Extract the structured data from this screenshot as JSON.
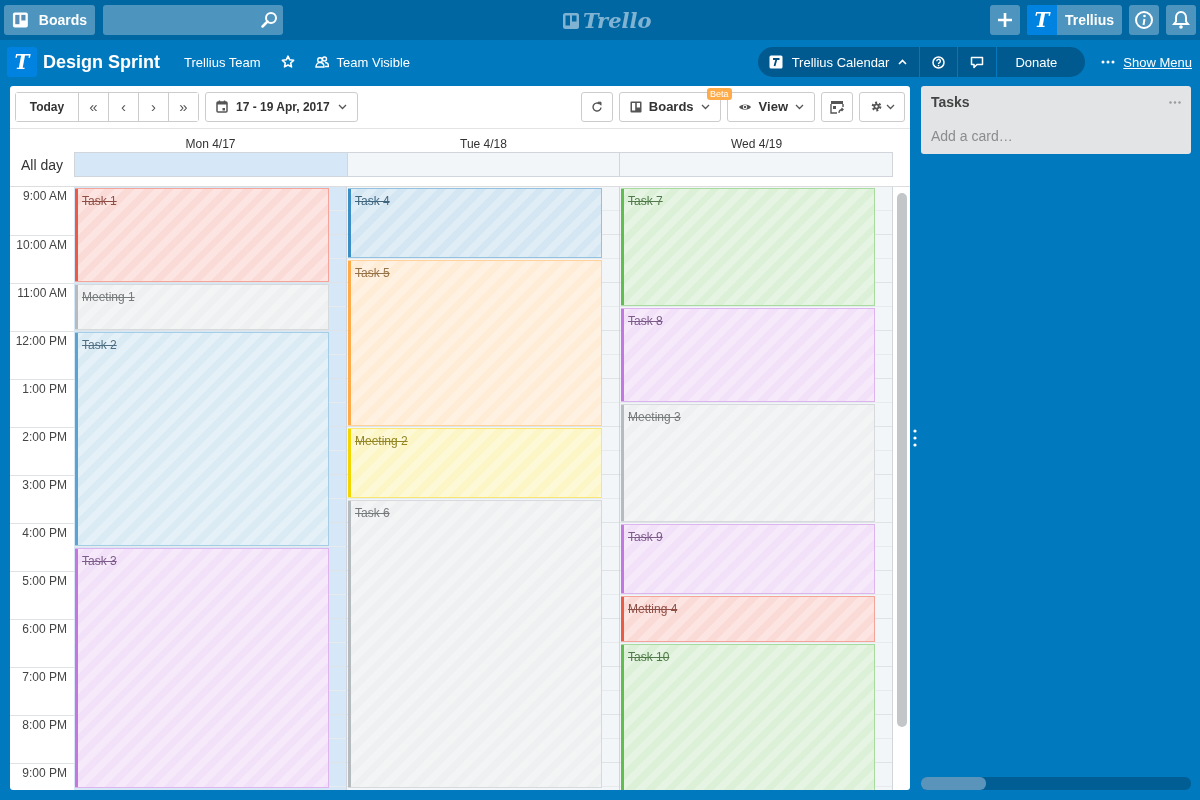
{
  "top_bar": {
    "boards_button": "Boards",
    "logo": "Trello",
    "avatar_letter": "T",
    "user": "Trellius"
  },
  "board": {
    "logo_letter": "T",
    "title": "Design Sprint",
    "team": "Trellius Team",
    "visibility": "Team Visible"
  },
  "powerup_bar": {
    "name": "Trellius Calendar",
    "donate": "Donate",
    "show_menu": "Show Menu"
  },
  "calendar": {
    "toolbar": {
      "today": "Today",
      "first": "«",
      "prev": "‹",
      "next": "›",
      "last": "»",
      "date_range": "17 - 19 Apr, 2017",
      "boards": "Boards",
      "beta_badge": "Beta",
      "view": "View"
    },
    "all_day_label": "All day",
    "times": [
      "9:00 AM",
      "10:00 AM",
      "11:00 AM",
      "12:00 PM",
      "1:00 PM",
      "2:00 PM",
      "3:00 PM",
      "4:00 PM",
      "5:00 PM",
      "6:00 PM",
      "7:00 PM",
      "8:00 PM",
      "9:00 PM"
    ],
    "days": [
      {
        "label": "Mon 4/17",
        "today": true,
        "events": [
          {
            "title": "Task 1",
            "color": "#eb5a46",
            "done": true
          },
          {
            "title": "Meeting 1",
            "color": "#b6bbbf",
            "done": true
          },
          {
            "title": "Task 2",
            "color": "#5ba4cf",
            "done": true
          },
          {
            "title": "Task 3",
            "color": "#c377e0",
            "done": true
          }
        ]
      },
      {
        "label": "Tue 4/18",
        "today": false,
        "events": [
          {
            "title": "Task 4",
            "color": "#3b8fc6",
            "done": true
          },
          {
            "title": "Task 5",
            "color": "#ffab4a",
            "done": true
          },
          {
            "title": "Meeting 2",
            "color": "#f2d600",
            "done": true
          },
          {
            "title": "Task 6",
            "color": "#b6bbbf",
            "done": true
          }
        ]
      },
      {
        "label": "Wed 4/19",
        "today": false,
        "events": [
          {
            "title": "Task 7",
            "color": "#61bd4f",
            "done": true
          },
          {
            "title": "Task 8",
            "color": "#c377e0",
            "done": true
          },
          {
            "title": "Meeting 3",
            "color": "#b6bbbf",
            "done": true
          },
          {
            "title": "Task 9",
            "color": "#c377e0",
            "done": true
          },
          {
            "title": "Metting 4",
            "color": "#eb5a46",
            "done": true
          },
          {
            "title": "Task 10",
            "color": "#61bd4f",
            "done": true
          }
        ]
      }
    ]
  },
  "list": {
    "title": "Tasks",
    "add_card": "Add a card…"
  }
}
